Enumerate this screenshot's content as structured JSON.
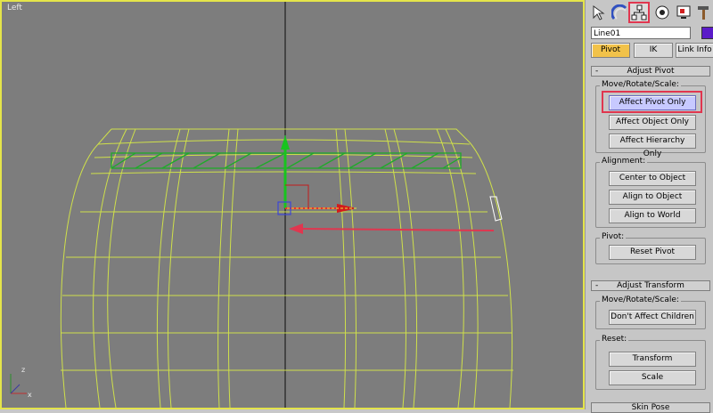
{
  "viewport": {
    "label": "Left",
    "axis_z": "z",
    "axis_x": "x"
  },
  "command_panel": {
    "tabs": [
      {
        "name": "create",
        "icon": "cursor-arrow-icon"
      },
      {
        "name": "modify",
        "icon": "modify-rainbow-icon"
      },
      {
        "name": "hierarchy",
        "icon": "hierarchy-icon",
        "active": true
      },
      {
        "name": "motion",
        "icon": "motion-wheel-icon"
      },
      {
        "name": "display",
        "icon": "display-monitor-icon"
      },
      {
        "name": "utilities",
        "icon": "hammer-icon"
      }
    ],
    "object_name": "Line01",
    "object_color": "#5a1ac8",
    "subtabs": [
      "Pivot",
      "IK",
      "Link Info"
    ],
    "adjust_pivot": {
      "title": "Adjust Pivot",
      "move_group": "Move/Rotate/Scale:",
      "affect_pivot_only": "Affect Pivot Only",
      "affect_object_only": "Affect Object Only",
      "affect_hierarchy_only": "Affect Hierarchy Only",
      "alignment_group": "Alignment:",
      "center_to_object": "Center to Object",
      "align_to_object": "Align to Object",
      "align_to_world": "Align to World",
      "pivot_group": "Pivot:",
      "reset_pivot": "Reset Pivot"
    },
    "adjust_transform": {
      "title": "Adjust Transform",
      "move_group": "Move/Rotate/Scale:",
      "dont_affect_children": "Don't Affect Children",
      "reset_group": "Reset:",
      "transform": "Transform",
      "scale": "Scale"
    },
    "skin_pose": "Skin Pose"
  }
}
